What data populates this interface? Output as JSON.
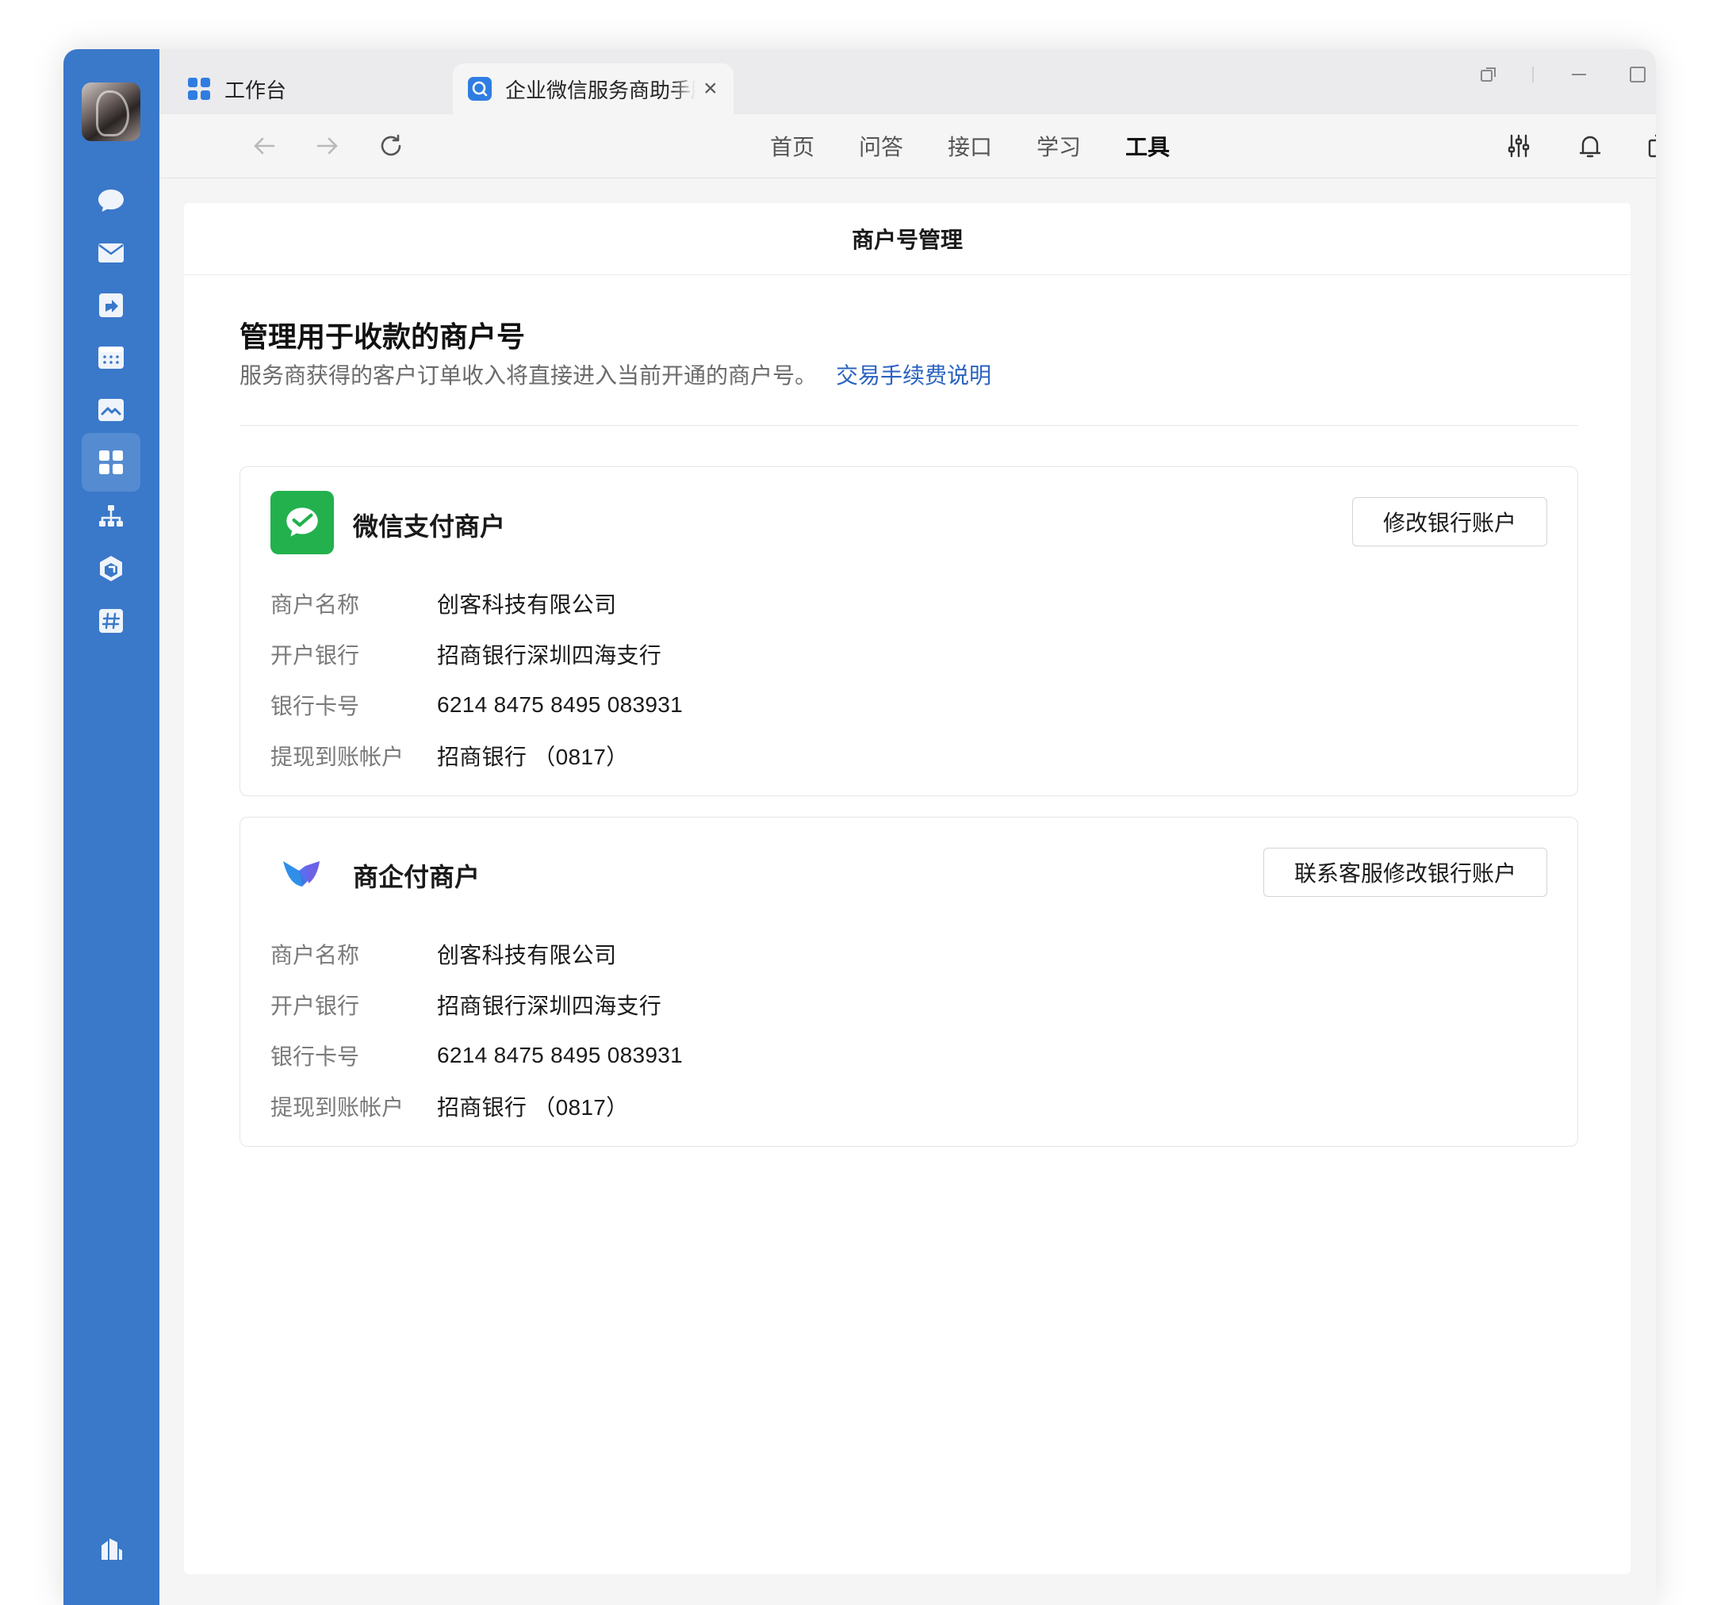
{
  "tabs": [
    {
      "label": "工作台",
      "icon": "workbench-grid-icon"
    },
    {
      "label": "企业微信服务商助手服务",
      "icon": "service-assistant-icon"
    }
  ],
  "nav": {
    "items": [
      "首页",
      "问答",
      "接口",
      "学习",
      "工具"
    ],
    "active": "工具"
  },
  "page": {
    "title": "商户号管理",
    "heading": "管理用于收款的商户号",
    "description": "服务商获得的客户订单收入将直接进入当前开通的商户号。",
    "link": "交易手续费说明"
  },
  "merchants": [
    {
      "title": "微信支付商户",
      "button": "修改银行账户",
      "fields": [
        {
          "label": "商户名称",
          "value": "创客科技有限公司"
        },
        {
          "label": "开户银行",
          "value": "招商银行深圳四海支行"
        },
        {
          "label": "银行卡号",
          "value": "6214 8475 8495 083931"
        },
        {
          "label": "提现到账帐户",
          "value": "招商银行 （0817）"
        }
      ]
    },
    {
      "title": "商企付商户",
      "button": "联系客服修改银行账户",
      "fields": [
        {
          "label": "商户名称",
          "value": "创客科技有限公司"
        },
        {
          "label": "开户银行",
          "value": "招商银行深圳四海支行"
        },
        {
          "label": "银行卡号",
          "value": "6214 8475 8495 083931"
        },
        {
          "label": "提现到账帐户",
          "value": "招商银行 （0817）"
        }
      ]
    }
  ],
  "colors": {
    "sidebar": "#3a78c9",
    "link": "#2b63c0",
    "wechat_green": "#22b14c"
  }
}
